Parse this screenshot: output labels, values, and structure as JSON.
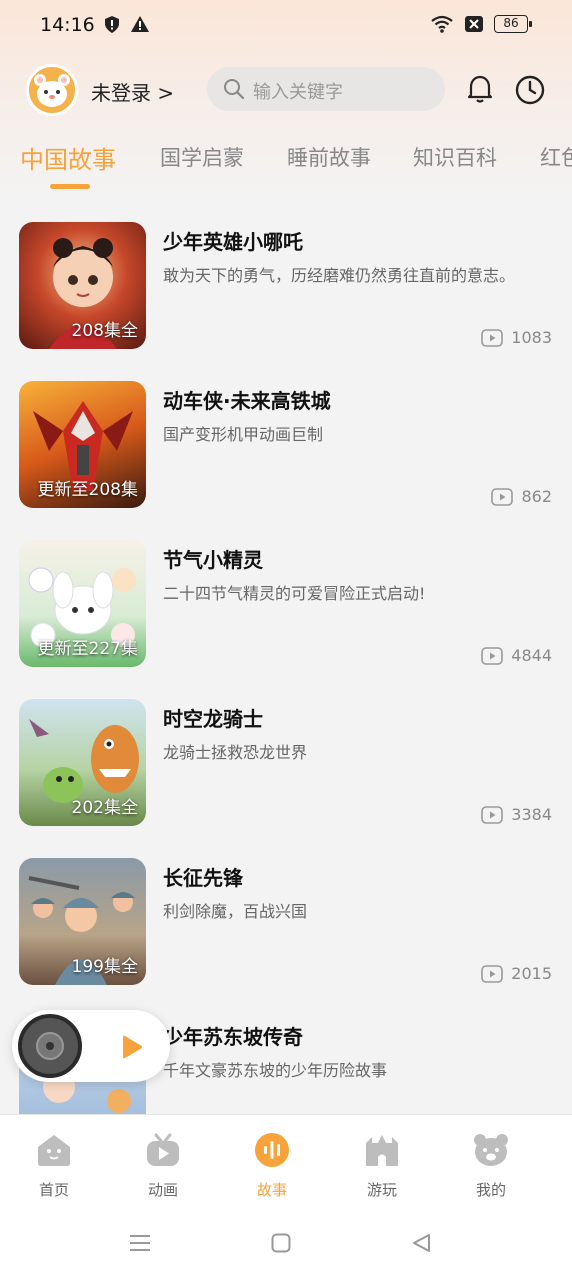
{
  "status_bar": {
    "time": "14:16",
    "battery": "86"
  },
  "header": {
    "login_text": "未登录 >",
    "search_placeholder": "输入关键字"
  },
  "tabs": [
    "中国故事",
    "国学启蒙",
    "睡前故事",
    "知识百科",
    "红色"
  ],
  "stories": [
    {
      "title": "少年英雄小哪吒",
      "desc": "敢为天下的勇气，历经磨难仍然勇往直前的意志。",
      "badge": "208集全",
      "plays": "1083"
    },
    {
      "title": "动车侠·未来高铁城",
      "desc": "国产变形机甲动画巨制",
      "badge": "更新至208集",
      "plays": "862"
    },
    {
      "title": "节气小精灵",
      "desc": "二十四节气精灵的可爱冒险正式启动!",
      "badge": "更新至227集",
      "plays": "4844"
    },
    {
      "title": "时空龙骑士",
      "desc": "龙骑士拯救恐龙世界",
      "badge": "202集全",
      "plays": "3384"
    },
    {
      "title": "长征先锋",
      "desc": "利剑除魔，百战兴国",
      "badge": "199集全",
      "plays": "2015"
    },
    {
      "title": "少年苏东坡传奇",
      "desc": "千年文豪苏东坡的少年历险故事",
      "badge": "",
      "plays": ""
    }
  ],
  "bottom_nav": [
    "首页",
    "动画",
    "故事",
    "游玩",
    "我的"
  ],
  "colors": {
    "accent": "#f7a23b"
  }
}
